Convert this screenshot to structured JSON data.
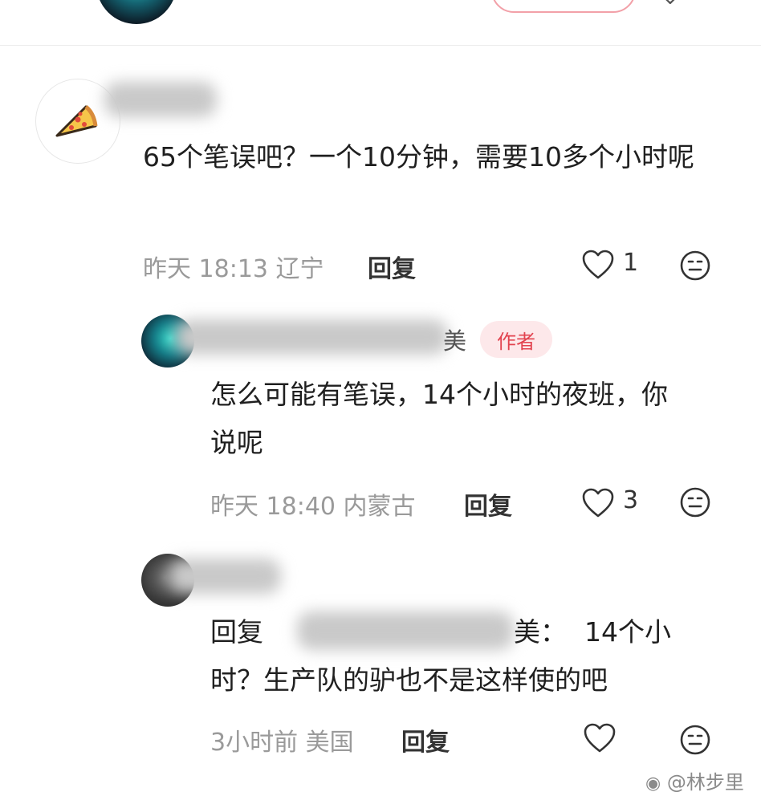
{
  "comments": [
    {
      "text": "65个笔误吧？一个10分钟，需要10多个小时呢",
      "meta": "昨天 18:13 辽宁",
      "reply_label": "回复",
      "likes": "1"
    },
    {
      "name_tail": "美",
      "badge": "作者",
      "text": "怎么可能有笔误，14个小时的夜班，你说呢",
      "meta": "昨天 18:40 内蒙古",
      "reply_label": "回复",
      "likes": "3"
    },
    {
      "text_prefix": "回复",
      "text_name_tail": "美：",
      "text_rest_line1": "14个小",
      "text_line2": "时？生产队的驴也不是这样使的吧",
      "meta": "3小时前 美国",
      "reply_label": "回复"
    }
  ],
  "watermark": "@林步里",
  "icons": {
    "like": "heart-outline-icon",
    "react": "face-icon",
    "avatar1": "pizza-icon"
  }
}
